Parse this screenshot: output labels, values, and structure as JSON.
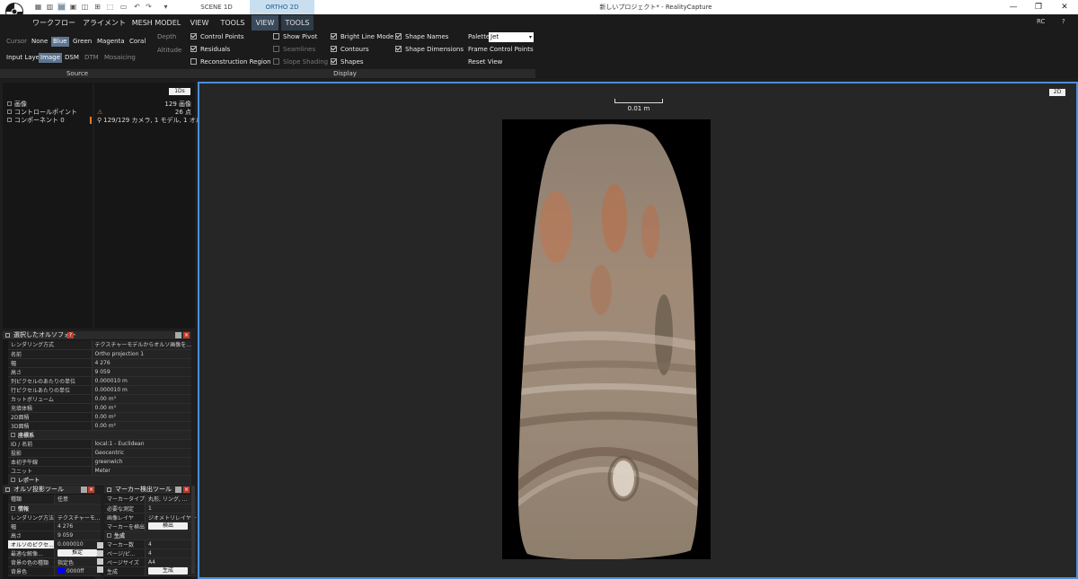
{
  "window": {
    "title": "新しいプロジェクト* - RealityCapture",
    "scene_tabs": [
      "SCENE 1D",
      "ORTHO 2D"
    ],
    "controls": [
      "—",
      "❐",
      "✕"
    ],
    "user_badge": "RC",
    "help_icon": "?"
  },
  "ribbon": {
    "tabs": [
      "ワークフロー",
      "アライメント",
      "MESH MODEL",
      "VIEW",
      "TOOLS",
      "VIEW",
      "TOOLS"
    ],
    "source": {
      "cursor_label": "Cursor",
      "cursor_options": [
        "None",
        "Blue",
        "Green",
        "Magenta",
        "Coral"
      ],
      "cursor_selected": "Blue",
      "input_layer_label": "Input Layer",
      "input_options": [
        "Image",
        "DSM",
        "DTM",
        "Mosaicing"
      ],
      "input_selected": "Image",
      "depth_label": "Depth",
      "altitude_label": "Altitude",
      "group_label": "Source"
    },
    "display": {
      "col1": [
        {
          "label": "Control Points",
          "checked": true
        },
        {
          "label": "Residuals",
          "checked": true
        },
        {
          "label": "Reconstruction Region",
          "checked": false
        }
      ],
      "col2": [
        {
          "label": "Show Pivot",
          "checked": false
        },
        {
          "label": "Seamlines",
          "checked": false
        },
        {
          "label": "Slope Shading",
          "checked": false
        }
      ],
      "col3": [
        {
          "label": "Bright Line Mode",
          "checked": true
        },
        {
          "label": "Contours",
          "checked": true
        },
        {
          "label": "Shapes",
          "checked": true
        }
      ],
      "col4": [
        {
          "label": "Shape Names",
          "checked": true
        },
        {
          "label": "Shape Dimensions",
          "checked": true
        }
      ],
      "palette_label": "Palette",
      "palette_value": "Jet",
      "frame_cp_label": "Frame Control Points",
      "reset_view_label": "Reset View",
      "group_label": "Display"
    }
  },
  "project_tree": {
    "badge": "1Ds",
    "items": [
      {
        "label": "画像",
        "value": "129 画像"
      },
      {
        "label": "コントロールポイント",
        "value": "26 点"
      },
      {
        "label": "コンポーネント 0",
        "value": "129/129 カメラ, 1 モデル, 1 オルソ"
      }
    ]
  },
  "ortho_panel": {
    "title": "選択したオルソフォト",
    "rows": [
      {
        "k": "レンダリング方式",
        "v": "テクスチャーモデルからオルソ画像を..."
      },
      {
        "k": "名前",
        "v": "Ortho projection 1"
      },
      {
        "k": "幅",
        "v": "4 276"
      },
      {
        "k": "高さ",
        "v": "9 059"
      },
      {
        "k": "列ピクセルのあたりの単位",
        "v": "0.000010 m"
      },
      {
        "k": "行ピクセルあたりの単位",
        "v": "0.000010 m"
      },
      {
        "k": "カットボリューム",
        "v": "0.00 m³"
      },
      {
        "k": "充填体積",
        "v": "0.00 m³"
      },
      {
        "k": "2D面積",
        "v": "0.00 m²"
      },
      {
        "k": "3D面積",
        "v": "0.00 m²"
      }
    ],
    "coord_section": "座標系",
    "coord_rows": [
      {
        "k": "ID / 名前",
        "v": "local:1 - Euclidean"
      },
      {
        "k": "投影",
        "v": "Geocentric"
      },
      {
        "k": "本初子午線",
        "v": "greenwich"
      },
      {
        "k": "ユニット",
        "v": "Meter"
      }
    ],
    "report_section": "レポート"
  },
  "ortho_tool": {
    "title": "オルソ投影ツール",
    "rows": [
      {
        "k": "種類",
        "v": "任意"
      }
    ],
    "info_section": "情報",
    "info_rows": [
      {
        "k": "レンダリング方法",
        "v": "テクスチャーモ..."
      },
      {
        "k": "幅",
        "v": "4 276"
      },
      {
        "k": "高さ",
        "v": "9 059"
      },
      {
        "k": "オルソのピクセ...",
        "v": "0.000010"
      },
      {
        "k": "最適な解像...",
        "v": "推定"
      },
      {
        "k": "背景の色の種類",
        "v": "指定色"
      },
      {
        "k": "背景色",
        "v": "0000ff"
      }
    ]
  },
  "marker_tool": {
    "title": "マーカー検出ツール",
    "rows": [
      {
        "k": "マーカータイプ",
        "v": "丸形, リング, ..."
      },
      {
        "k": "必要な測定",
        "v": "1"
      },
      {
        "k": "画像レイヤ",
        "v": "ジオメトリレイヤー"
      },
      {
        "k": "マーカーを検出",
        "v": "検出"
      }
    ],
    "gen_section": "生成",
    "gen_rows": [
      {
        "k": "マーカー数",
        "v": "4"
      },
      {
        "k": "ページ/ピ...",
        "v": "4"
      },
      {
        "k": "ページサイズ",
        "v": "A4"
      },
      {
        "k": "生成",
        "v": "生成"
      }
    ]
  },
  "viewport": {
    "badge": "2D",
    "scale_label": "0.01 m"
  },
  "colors": {
    "accent": "#4b8fd8",
    "selected_button": "#5d7590",
    "background_swatch": "#0000ff"
  }
}
